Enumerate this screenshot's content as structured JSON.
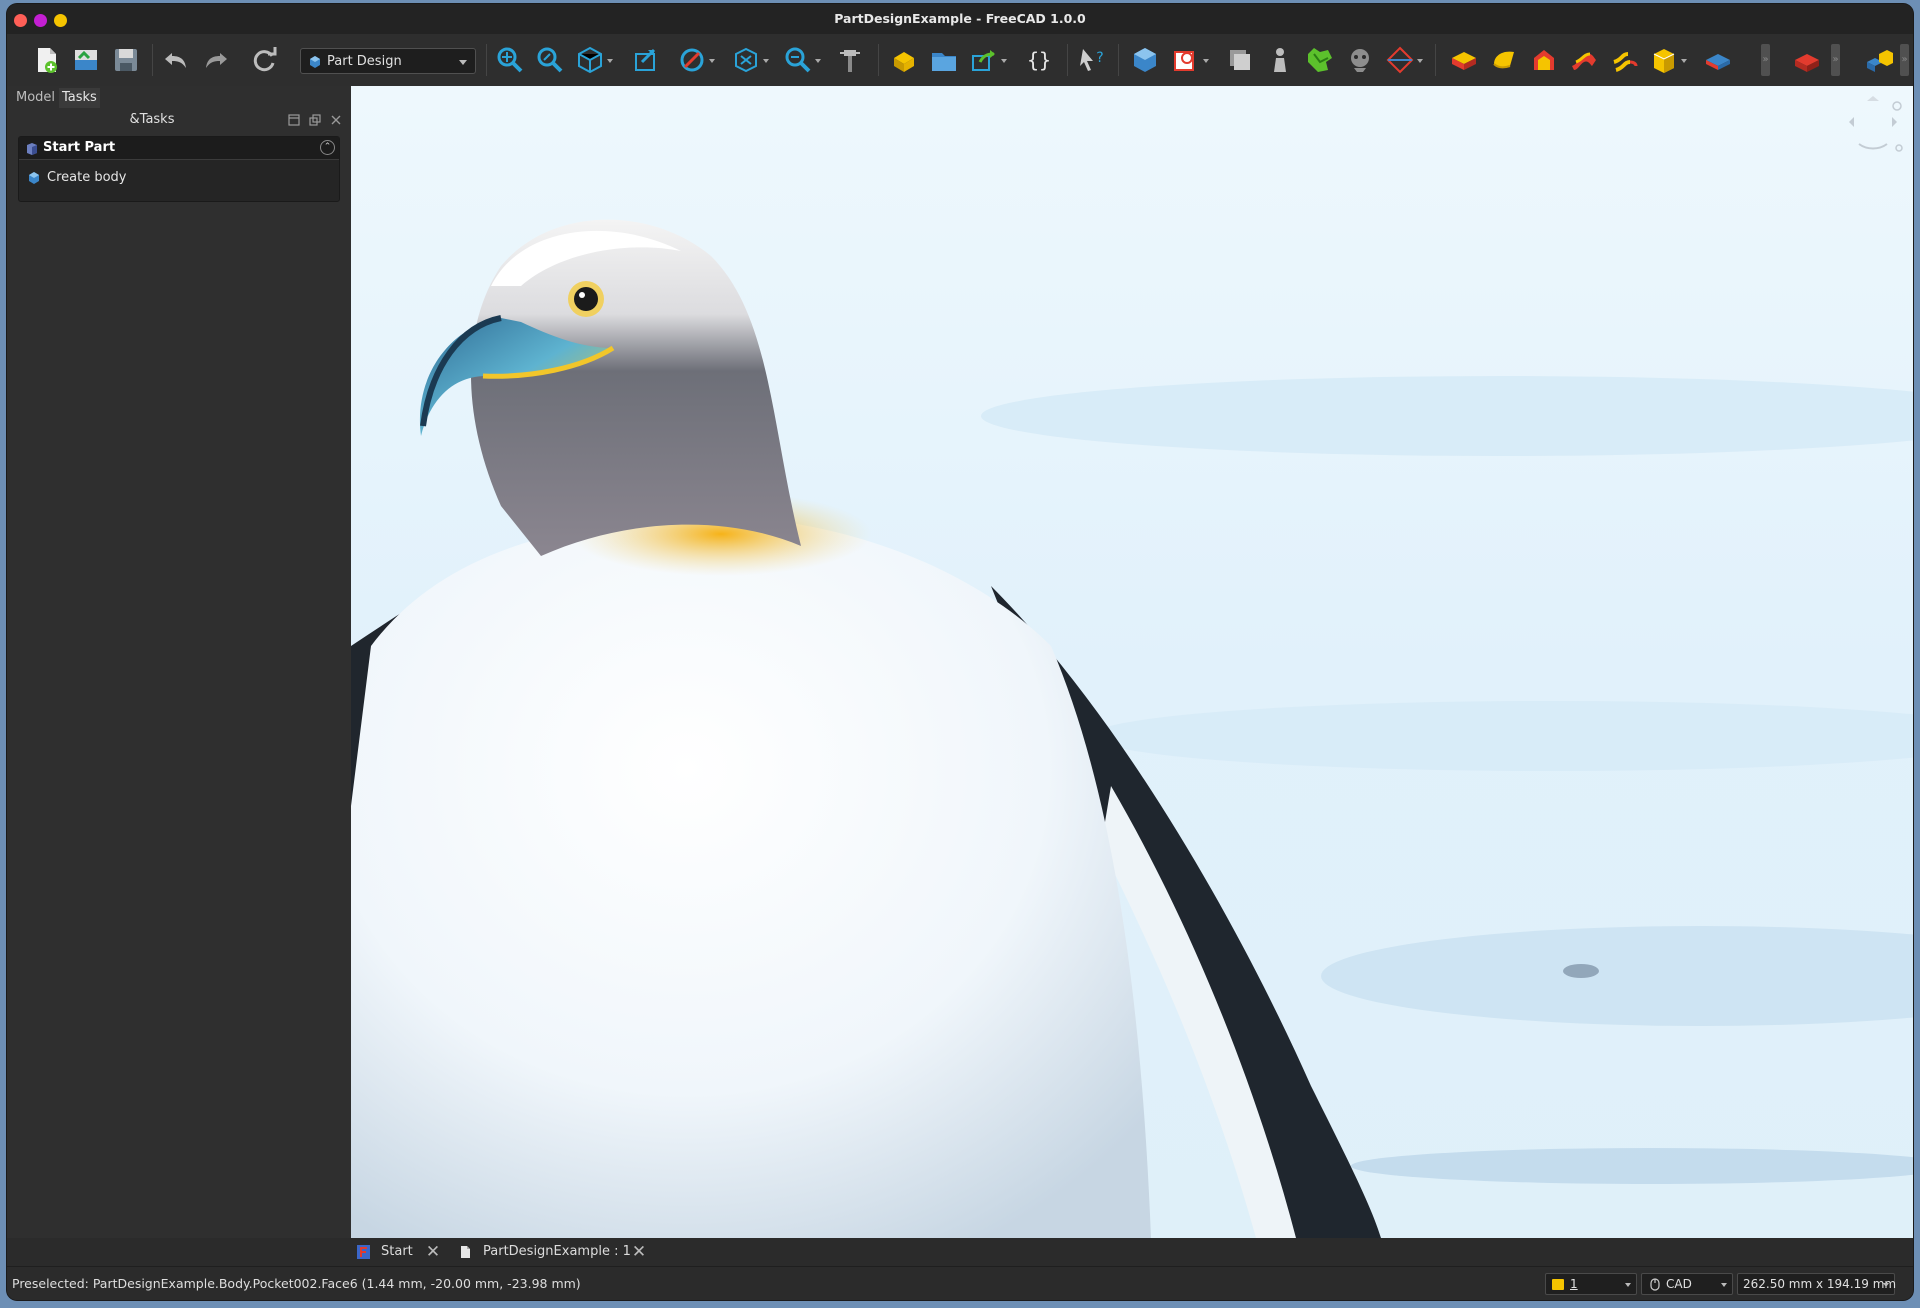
{
  "window": {
    "title": "PartDesignExample - FreeCAD 1.0.0"
  },
  "toolbar": {
    "workbench_selector": {
      "value": "Part Design"
    }
  },
  "left_panel": {
    "tabs": [
      {
        "label": "Model",
        "active": false
      },
      {
        "label": "Tasks",
        "active": true
      }
    ],
    "title": "&Tasks",
    "task_group": {
      "header": "Start Part",
      "items": [
        {
          "label": "Create body"
        }
      ]
    }
  },
  "viewport": {
    "content": "penguin-eagle-photo",
    "colors": {
      "sky": "#e4f2fb",
      "beak_yellow": "#f2c62a",
      "plumage_dark": "#222a33"
    }
  },
  "document_tabs": [
    {
      "label": "Start"
    },
    {
      "label": "PartDesignExample : 1"
    }
  ],
  "statusbar": {
    "message": "Preselected: PartDesignExample.Body.Pocket002.Face6 (1.44 mm, -20.00 mm, -23.98 mm)",
    "notifications": "1",
    "navigation_style": "CAD",
    "dimensions": "262.50 mm x 194.19 mm"
  },
  "colors": {
    "window_bg": "#2b2b2b",
    "titlebar_bg": "#232323",
    "accent_blue": "#2aa3d8",
    "accent_yellow": "#f5c400",
    "accent_red": "#e33b2e",
    "accent_green": "#5cc12c"
  }
}
